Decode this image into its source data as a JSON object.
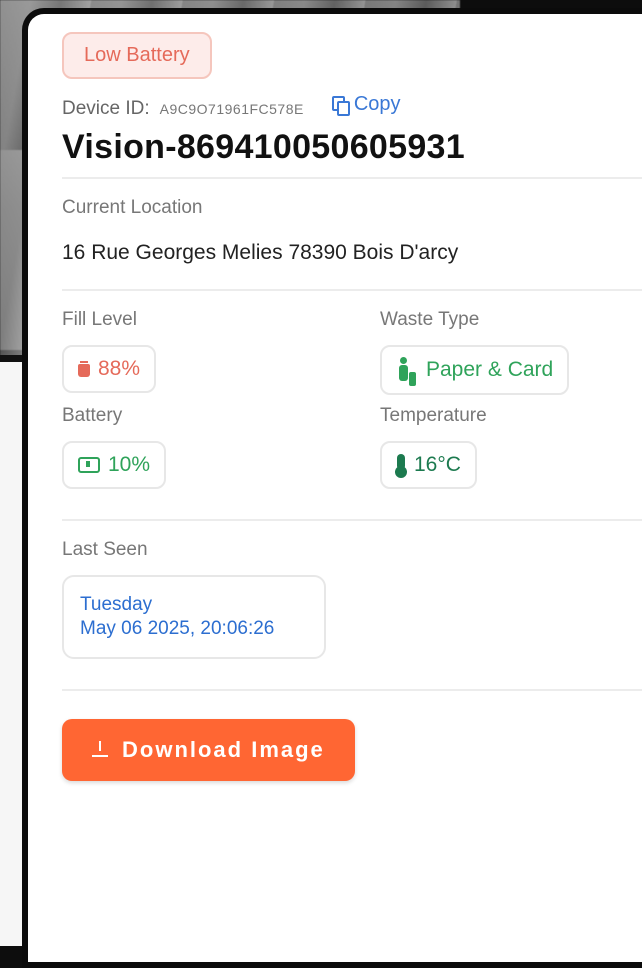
{
  "status_badge": "Low Battery",
  "device": {
    "id_label": "Device ID:",
    "id_value": "A9C9O71961FC578E",
    "copy_label": "Copy",
    "name": "Vision-869410050605931"
  },
  "location": {
    "label": "Current Location",
    "value": "16 Rue Georges Melies 78390 Bois D'arcy"
  },
  "metrics": {
    "fill_level": {
      "label": "Fill Level",
      "value": "88%",
      "icon": "trash-icon"
    },
    "waste_type": {
      "label": "Waste Type",
      "value": "Paper & Card",
      "icon": "recycle-person-icon"
    },
    "battery": {
      "label": "Battery",
      "value": "10%",
      "icon": "battery-icon"
    },
    "temperature": {
      "label": "Temperature",
      "value": "16°C",
      "icon": "thermometer-icon"
    }
  },
  "last_seen": {
    "label": "Last Seen",
    "day": "Tuesday",
    "datetime": "May 06 2025, 20:06:26"
  },
  "actions": {
    "download_label": "Download Image",
    "download_icon": "download-icon"
  },
  "colors": {
    "accent": "#ff6633",
    "alert": "#e56a5a",
    "ok": "#2fa35a",
    "link": "#3a78d6"
  }
}
